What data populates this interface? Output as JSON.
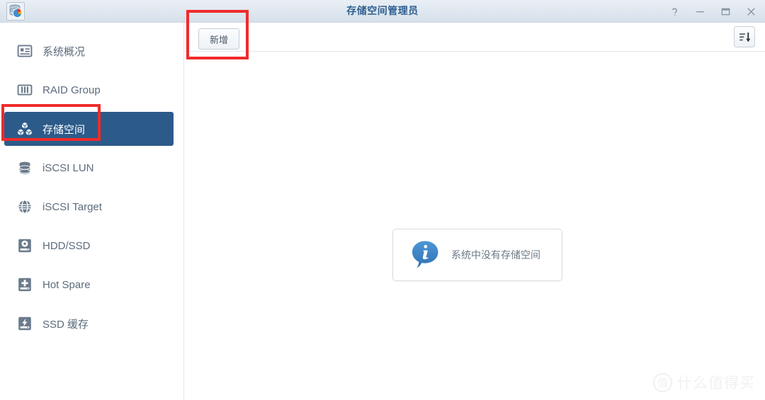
{
  "window": {
    "title": "存储空间管理员",
    "app_icon": "storage-manager-icon",
    "controls": [
      {
        "name": "help-button",
        "glyph": "?"
      },
      {
        "name": "minimize-button",
        "glyph": "−"
      },
      {
        "name": "maximize-button",
        "glyph": "▢"
      },
      {
        "name": "close-button",
        "glyph": "✕"
      }
    ]
  },
  "sidebar": {
    "items": [
      {
        "label": "系统概况",
        "icon": "overview-card-icon",
        "selected": false
      },
      {
        "label": "RAID Group",
        "icon": "raid-bars-icon",
        "selected": false
      },
      {
        "label": "存储空间",
        "icon": "storage-blocks-icon",
        "selected": true
      },
      {
        "label": "iSCSI LUN",
        "icon": "disk-stack-icon",
        "selected": false
      },
      {
        "label": "iSCSI Target",
        "icon": "globe-icon",
        "selected": false
      },
      {
        "label": "HDD/SSD",
        "icon": "hard-disk-icon",
        "selected": false
      },
      {
        "label": "Hot Spare",
        "icon": "plus-disk-icon",
        "selected": false
      },
      {
        "label": "SSD 缓存",
        "icon": "lightning-disk-icon",
        "selected": false
      }
    ]
  },
  "toolbar": {
    "add_label": "新增",
    "sort_icon": "sort-descending-icon"
  },
  "empty_state": {
    "message": "系统中没有存储空间",
    "icon": "info-bubble-icon"
  },
  "watermark": {
    "mark": "值",
    "text": "什么值得买"
  },
  "colors": {
    "titlebar_text": "#2f5f90",
    "selected_nav_bg": "#2c5b8a",
    "nav_text": "#5b6b7c",
    "info_blue": "#3b7fc4",
    "annotation_red": "#f02b2b"
  }
}
